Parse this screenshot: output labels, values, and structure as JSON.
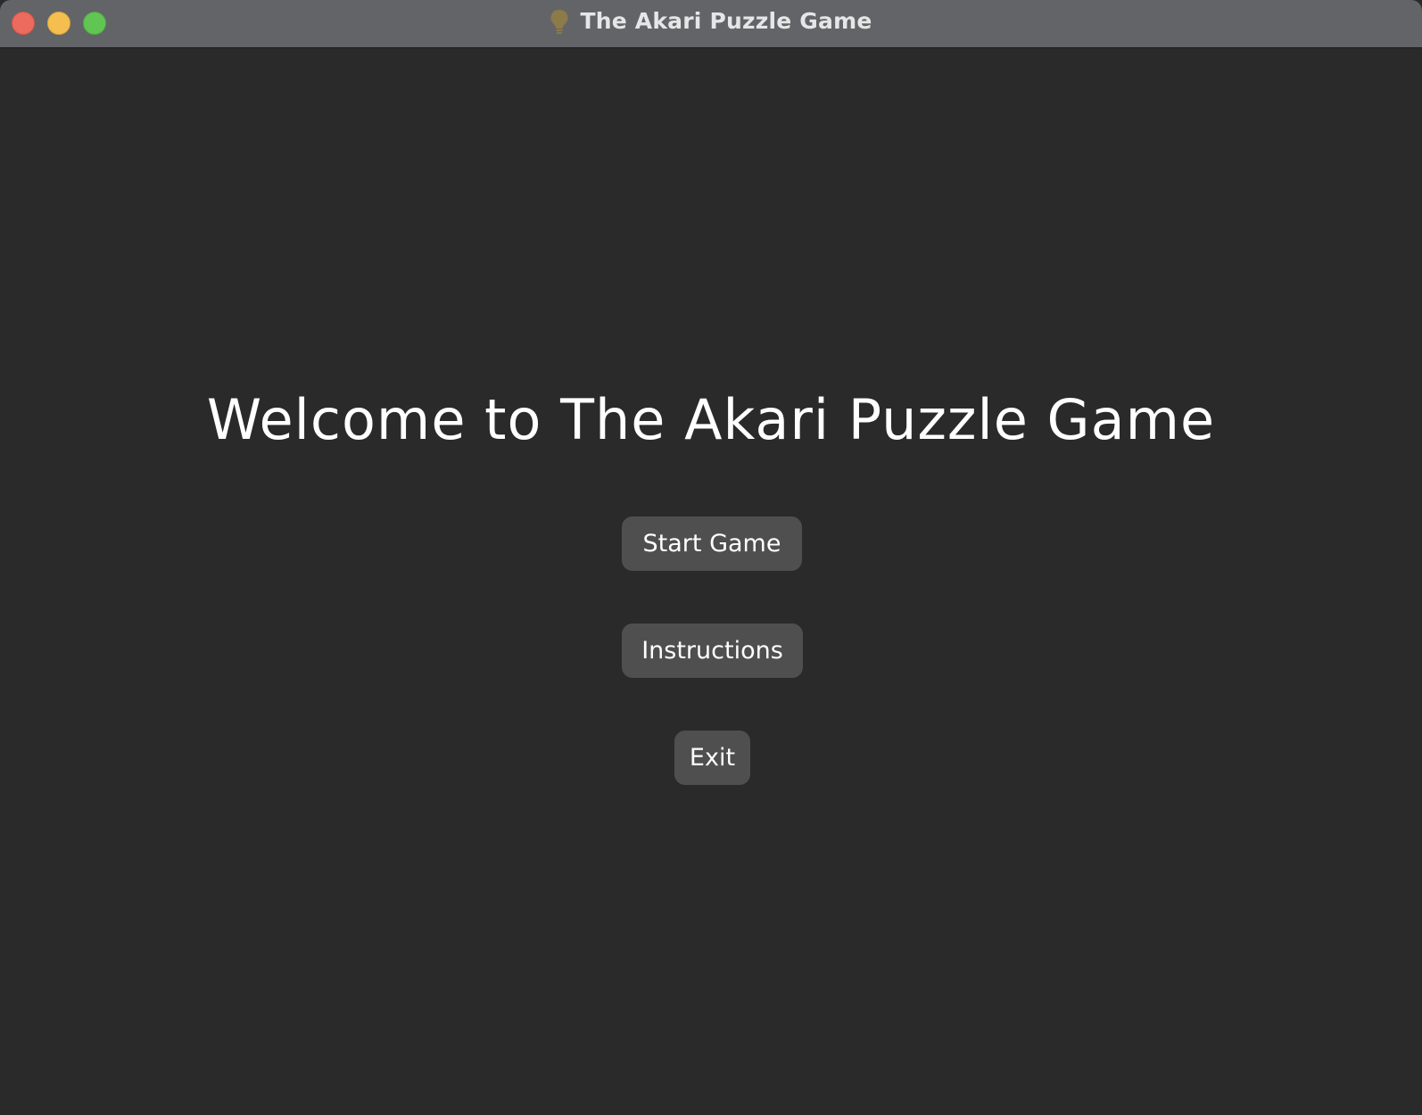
{
  "window": {
    "title": "The Akari Puzzle Game",
    "title_icon": "lightbulb-icon",
    "controls": [
      "close",
      "minimize",
      "zoom"
    ]
  },
  "main": {
    "heading": "Welcome to The Akari Puzzle Game",
    "buttons": {
      "start": "Start Game",
      "instructions": "Instructions",
      "exit": "Exit"
    }
  },
  "colors": {
    "background": "#2a2a2a",
    "titlebar": "#636468",
    "button": "#4f4f4f",
    "text": "#ffffff",
    "close": "#ed6a5e",
    "minimize": "#f5bf4f",
    "zoom": "#61c554",
    "bulb": "#8c7a48"
  }
}
